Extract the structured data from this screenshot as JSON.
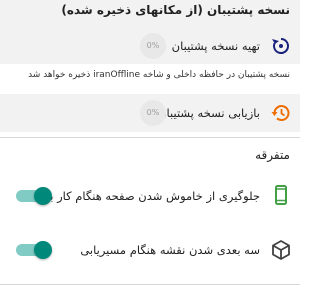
{
  "backup_section": {
    "header": "نسخه پشتیبان (از مکانهای ذخیره شده)",
    "create_backup": {
      "label": "تهیه نسخه پشتیبان",
      "progress": "0%",
      "icon": "backup-icon",
      "icon_color": "#1a237e"
    },
    "note": "نسخه پشتیبان در حافظه داخلی و شاخه iranOffline ذخیره خواهد شد",
    "restore_backup": {
      "label": "بازیابی نسخه پشتیبان",
      "progress": "0%",
      "icon": "restore-icon",
      "icon_color": "#ef6c00"
    }
  },
  "misc_section": {
    "header": "متفرقه",
    "settings": [
      {
        "label": "جلوگیری از خاموش شدن صفحه هنگام کار با نقشه",
        "icon": "phone-icon",
        "icon_color": "#43a047",
        "enabled": true
      },
      {
        "label": "سه بعدی شدن نقشه هنگام مسیریابی",
        "icon": "cube-icon",
        "icon_color": "#424242",
        "enabled": true
      }
    ]
  },
  "colors": {
    "toggle_on": "#00897b",
    "toggle_track": "#80cbc4",
    "section_bg": "#f2f2f2"
  }
}
